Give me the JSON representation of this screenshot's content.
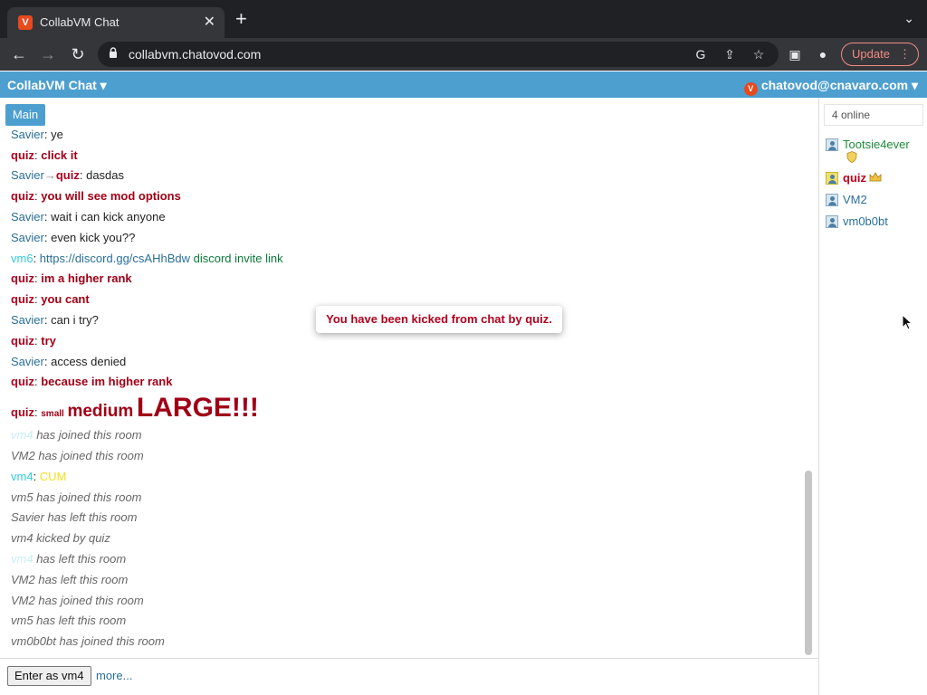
{
  "browser": {
    "tab_title": "CollabVM Chat",
    "tab_icon": "V",
    "url": "collabvm.chatovod.com",
    "update_label": "Update"
  },
  "app": {
    "brand": "CollabVM Chat",
    "user": "chatovod@cnavaro.com",
    "room_tab": "Main",
    "accent_color": "#4d9fd0"
  },
  "chat": {
    "messages": [
      {
        "user": "Savier",
        "sep": ": ",
        "text": "ye"
      },
      {
        "user": "quiz",
        "sep": ": ",
        "text": "click it"
      },
      {
        "user": "Savier",
        "arrow": "→",
        "to": "quiz",
        "sep": ": ",
        "text": "dasdas"
      },
      {
        "user": "quiz",
        "sep": ": ",
        "text": "you will see mod options"
      },
      {
        "user": "Savier",
        "sep": ": ",
        "text": "wait i can kick anyone"
      },
      {
        "user": "Savier",
        "sep": ": ",
        "text": "even kick you??"
      },
      {
        "user": "vm6",
        "sep": ": ",
        "link": "https://discord.gg/csAHhBdw",
        "text": "discord invite link"
      },
      {
        "user": "quiz",
        "sep": ": ",
        "text": "im a higher rank"
      },
      {
        "user": "quiz",
        "sep": ": ",
        "text": "you cant"
      },
      {
        "user": "Savier",
        "sep": ": ",
        "text": "can i try?"
      },
      {
        "user": "quiz",
        "sep": ": ",
        "text": "try"
      },
      {
        "user": "Savier",
        "sep": ": ",
        "text": "access denied"
      },
      {
        "user": "quiz",
        "sep": ": ",
        "text": "because im higher rank"
      },
      {
        "user": "quiz",
        "sep": ": ",
        "small": "small",
        "medium": "medium",
        "large": "LARGE!!!"
      },
      {
        "user": "vm4",
        "text": "has joined this room"
      },
      {
        "text": "VM2 has joined this room"
      },
      {
        "user": "vm4",
        "sep": ": ",
        "text": "CUM"
      },
      {
        "text": "vm5 has joined this room"
      },
      {
        "text": "Savier has left this room"
      },
      {
        "text": "vm4 kicked by quiz"
      },
      {
        "user": "vm4",
        "text": "has left this room"
      },
      {
        "text": "VM2 has left this room"
      },
      {
        "text": "VM2 has joined this room"
      },
      {
        "text": "vm5 has left this room"
      },
      {
        "text": "vm0b0bt has joined this room"
      }
    ]
  },
  "toast": "You have been kicked from chat by quiz.",
  "footer": {
    "enter_label": "Enter as vm4",
    "more_label": "more..."
  },
  "sidebar": {
    "online": "4 online",
    "users": [
      {
        "name": "Tootsie4ever",
        "badge": "shield-icon"
      },
      {
        "name": "quiz",
        "badge": "crown-icon"
      },
      {
        "name": "VM2"
      },
      {
        "name": "vm0b0bt"
      }
    ]
  }
}
